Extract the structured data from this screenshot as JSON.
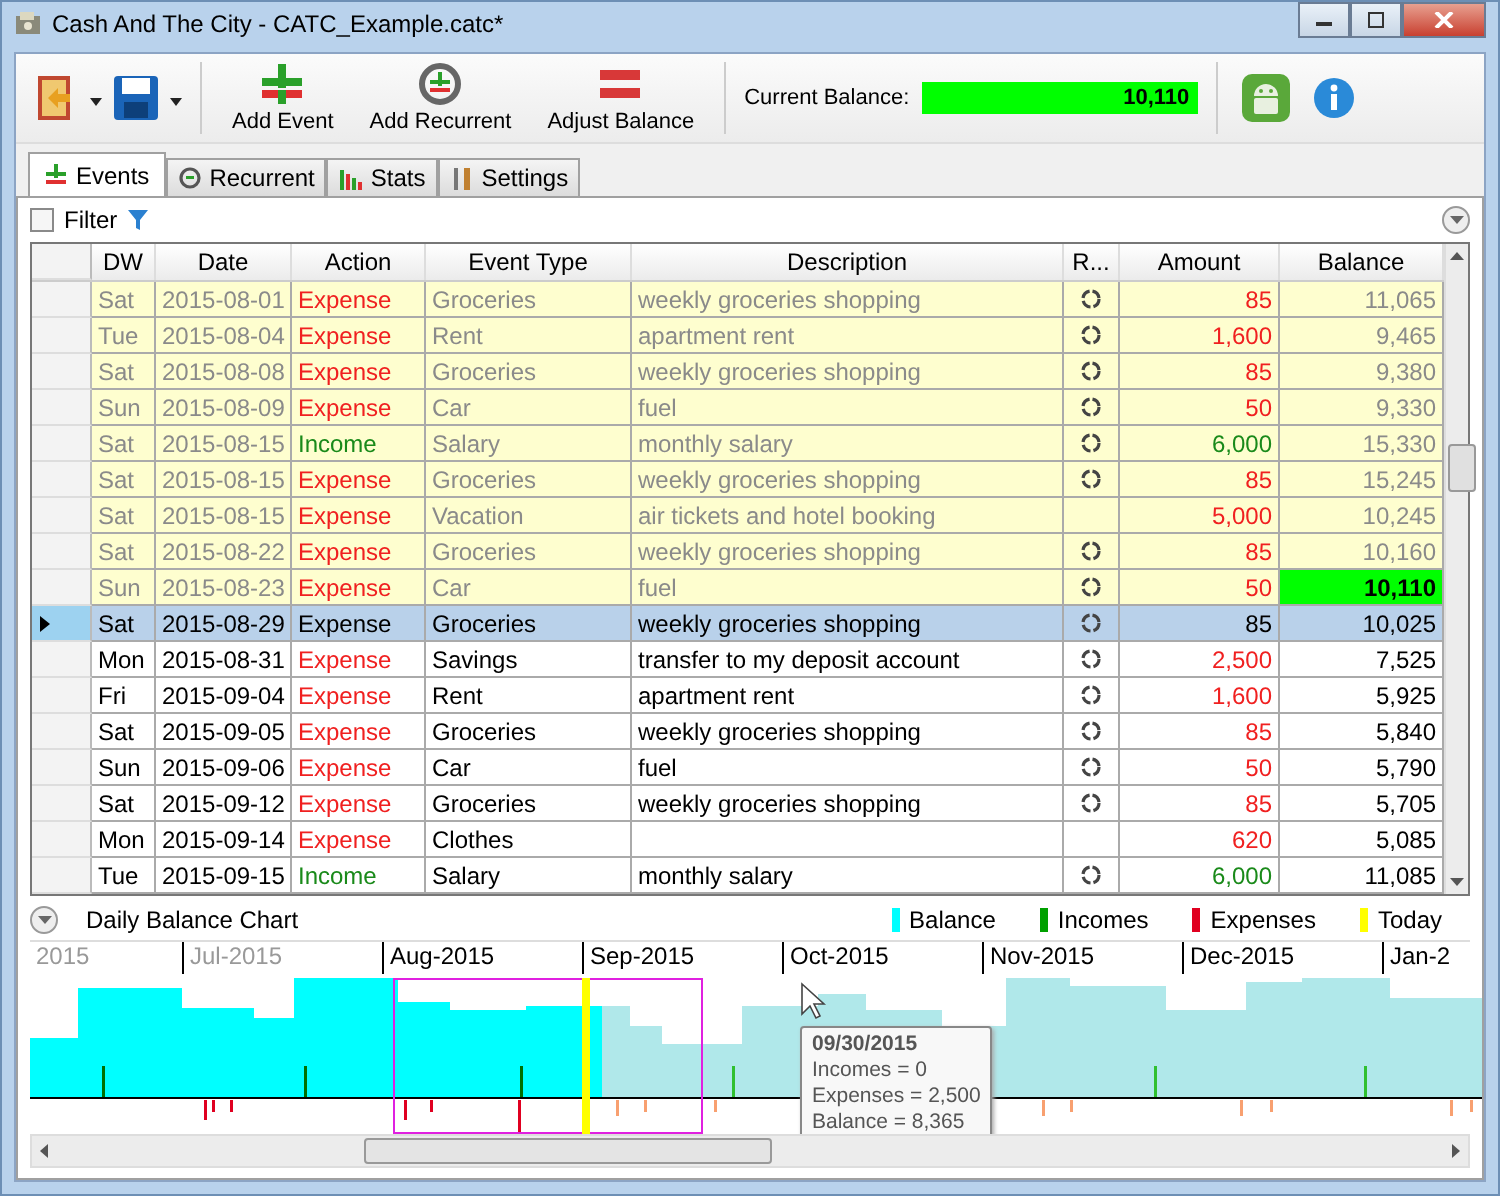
{
  "window": {
    "title": "Cash And The City - CATC_Example.catc*"
  },
  "toolbar": {
    "buttons": [
      {
        "label": "Add Event",
        "kind": "add"
      },
      {
        "label": "Add Recurrent",
        "kind": "recurrent"
      },
      {
        "label": "Adjust Balance",
        "kind": "adjust"
      }
    ],
    "balance_label": "Current Balance:",
    "balance_value": "10,110"
  },
  "tabs": [
    {
      "label": "Events",
      "kind": "events",
      "selected": true
    },
    {
      "label": "Recurrent",
      "kind": "recurrent",
      "selected": false
    },
    {
      "label": "Stats",
      "kind": "stats",
      "selected": false
    },
    {
      "label": "Settings",
      "kind": "settings",
      "selected": false
    }
  ],
  "filter": {
    "label": "Filter",
    "checked": false
  },
  "table": {
    "columns": [
      "DW",
      "Date",
      "Action",
      "Event Type",
      "Description",
      "R...",
      "Amount",
      "Balance"
    ],
    "rows": [
      {
        "dw": "Sat",
        "date": "2015-08-01",
        "action": "Expense",
        "kind": "expense",
        "event_type": "Groceries",
        "description": "weekly groceries shopping",
        "recurrent": true,
        "amount": "85",
        "balance": "11,065",
        "past": true,
        "current": false,
        "selected": false
      },
      {
        "dw": "Tue",
        "date": "2015-08-04",
        "action": "Expense",
        "kind": "expense",
        "event_type": "Rent",
        "description": "apartment rent",
        "recurrent": true,
        "amount": "1,600",
        "balance": "9,465",
        "past": true,
        "current": false,
        "selected": false
      },
      {
        "dw": "Sat",
        "date": "2015-08-08",
        "action": "Expense",
        "kind": "expense",
        "event_type": "Groceries",
        "description": "weekly groceries shopping",
        "recurrent": true,
        "amount": "85",
        "balance": "9,380",
        "past": true,
        "current": false,
        "selected": false
      },
      {
        "dw": "Sun",
        "date": "2015-08-09",
        "action": "Expense",
        "kind": "expense",
        "event_type": "Car",
        "description": "fuel",
        "recurrent": true,
        "amount": "50",
        "balance": "9,330",
        "past": true,
        "current": false,
        "selected": false
      },
      {
        "dw": "Sat",
        "date": "2015-08-15",
        "action": "Income",
        "kind": "income",
        "event_type": "Salary",
        "description": "monthly salary",
        "recurrent": true,
        "amount": "6,000",
        "balance": "15,330",
        "past": true,
        "current": false,
        "selected": false
      },
      {
        "dw": "Sat",
        "date": "2015-08-15",
        "action": "Expense",
        "kind": "expense",
        "event_type": "Groceries",
        "description": "weekly groceries shopping",
        "recurrent": true,
        "amount": "85",
        "balance": "15,245",
        "past": true,
        "current": false,
        "selected": false
      },
      {
        "dw": "Sat",
        "date": "2015-08-15",
        "action": "Expense",
        "kind": "expense",
        "event_type": "Vacation",
        "description": "air tickets and hotel booking",
        "recurrent": false,
        "amount": "5,000",
        "balance": "10,245",
        "past": true,
        "current": false,
        "selected": false
      },
      {
        "dw": "Sat",
        "date": "2015-08-22",
        "action": "Expense",
        "kind": "expense",
        "event_type": "Groceries",
        "description": "weekly groceries shopping",
        "recurrent": true,
        "amount": "85",
        "balance": "10,160",
        "past": true,
        "current": false,
        "selected": false
      },
      {
        "dw": "Sun",
        "date": "2015-08-23",
        "action": "Expense",
        "kind": "expense",
        "event_type": "Car",
        "description": "fuel",
        "recurrent": true,
        "amount": "50",
        "balance": "10,110",
        "past": true,
        "current": true,
        "selected": false
      },
      {
        "dw": "Sat",
        "date": "2015-08-29",
        "action": "Expense",
        "kind": "expense",
        "event_type": "Groceries",
        "description": "weekly groceries shopping",
        "recurrent": true,
        "amount": "85",
        "balance": "10,025",
        "past": false,
        "current": false,
        "selected": true
      },
      {
        "dw": "Mon",
        "date": "2015-08-31",
        "action": "Expense",
        "kind": "expense",
        "event_type": "Savings",
        "description": "transfer to my deposit account",
        "recurrent": true,
        "amount": "2,500",
        "balance": "7,525",
        "past": false,
        "current": false,
        "selected": false
      },
      {
        "dw": "Fri",
        "date": "2015-09-04",
        "action": "Expense",
        "kind": "expense",
        "event_type": "Rent",
        "description": "apartment rent",
        "recurrent": true,
        "amount": "1,600",
        "balance": "5,925",
        "past": false,
        "current": false,
        "selected": false
      },
      {
        "dw": "Sat",
        "date": "2015-09-05",
        "action": "Expense",
        "kind": "expense",
        "event_type": "Groceries",
        "description": "weekly groceries shopping",
        "recurrent": true,
        "amount": "85",
        "balance": "5,840",
        "past": false,
        "current": false,
        "selected": false
      },
      {
        "dw": "Sun",
        "date": "2015-09-06",
        "action": "Expense",
        "kind": "expense",
        "event_type": "Car",
        "description": "fuel",
        "recurrent": true,
        "amount": "50",
        "balance": "5,790",
        "past": false,
        "current": false,
        "selected": false
      },
      {
        "dw": "Sat",
        "date": "2015-09-12",
        "action": "Expense",
        "kind": "expense",
        "event_type": "Groceries",
        "description": "weekly groceries shopping",
        "recurrent": true,
        "amount": "85",
        "balance": "5,705",
        "past": false,
        "current": false,
        "selected": false
      },
      {
        "dw": "Mon",
        "date": "2015-09-14",
        "action": "Expense",
        "kind": "expense",
        "event_type": "Clothes",
        "recurrent": false,
        "amount": "620",
        "balance": "5,085",
        "past": false,
        "current": false,
        "selected": false
      },
      {
        "dw": "Tue",
        "date": "2015-09-15",
        "action": "Income",
        "kind": "income",
        "event_type": "Salary",
        "description": "monthly salary",
        "recurrent": true,
        "amount": "6,000",
        "balance": "11,085",
        "past": false,
        "current": false,
        "selected": false
      }
    ]
  },
  "chart": {
    "title": "Daily Balance Chart",
    "expanded": true,
    "legend": [
      {
        "label": "Balance",
        "color": "#00ffff"
      },
      {
        "label": "Incomes",
        "color": "#00a000"
      },
      {
        "label": "Expenses",
        "color": "#e00020"
      },
      {
        "label": "Today",
        "color": "#ffff00"
      }
    ],
    "months": [
      {
        "label": "2015",
        "in_view": false
      },
      {
        "label": "Jul-2015",
        "in_view": false
      },
      {
        "label": "Aug-2015",
        "in_view": true
      },
      {
        "label": "Sep-2015",
        "in_view": true
      },
      {
        "label": "Oct-2015",
        "in_view": true
      },
      {
        "label": "Nov-2015",
        "in_view": true
      },
      {
        "label": "Dec-2015",
        "in_view": true
      },
      {
        "label": "Jan-2",
        "in_view": true
      }
    ],
    "tooltip": {
      "title": "09/30/2015",
      "lines": [
        "Incomes = 0",
        "Expenses = 2,500",
        "Balance = 8,365"
      ]
    }
  }
}
